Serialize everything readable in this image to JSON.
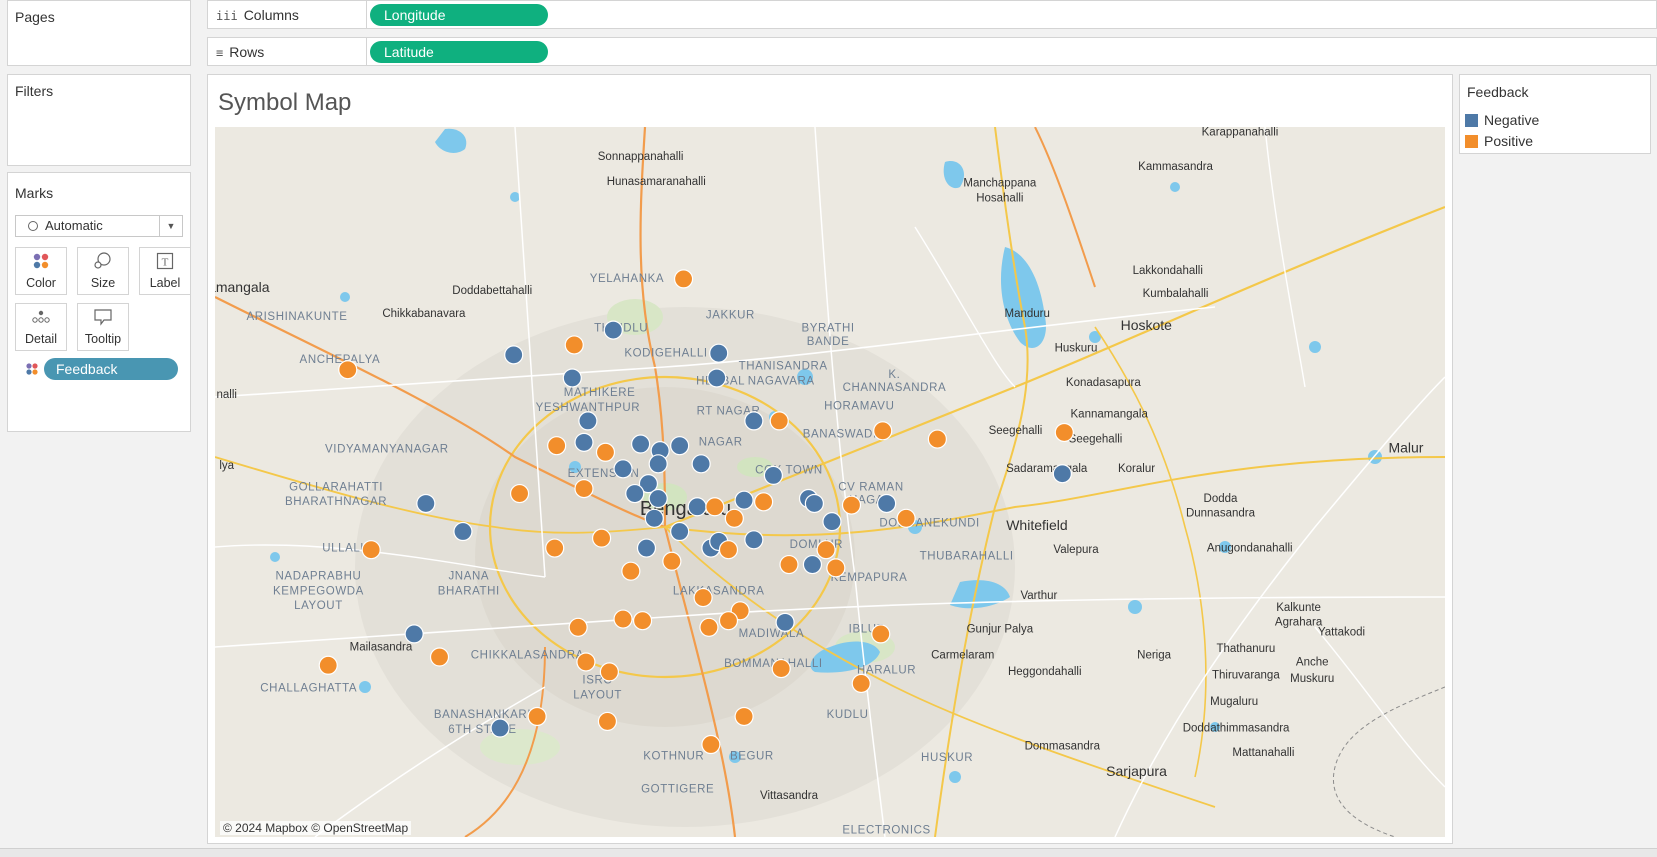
{
  "pages_card": {
    "title": "Pages"
  },
  "filters_card": {
    "title": "Filters"
  },
  "shelves": {
    "columns": {
      "icon": "iii",
      "label": "Columns",
      "pill": "Longitude"
    },
    "rows": {
      "icon": "≡",
      "label": "Rows",
      "pill": "Latitude"
    }
  },
  "marks": {
    "title": "Marks",
    "mark_type": "Automatic",
    "buttons": {
      "color": "Color",
      "size": "Size",
      "label": "Label",
      "detail": "Detail",
      "tooltip": "Tooltip"
    },
    "field_pill": "Feedback"
  },
  "viz": {
    "title": "Symbol Map",
    "attribution": "© 2024 Mapbox © OpenStreetMap"
  },
  "legend": {
    "title": "Feedback",
    "items": [
      {
        "label": "Negative",
        "color": "#4e79a7"
      },
      {
        "label": "Positive",
        "color": "#f28e2b"
      }
    ]
  },
  "colors": {
    "negative": "#4e79a7",
    "positive": "#f28e2b",
    "pill_green": "#0fb07f",
    "pill_blue": "#4996b2"
  },
  "map_labels": [
    {
      "t": "Sonnappanahalli",
      "lon": 77.548,
      "lat": 13.17
    },
    {
      "t": "Hunasamaranahalli",
      "lon": 77.556,
      "lat": 13.155
    },
    {
      "t": "Karappanahalli",
      "lon": 77.855,
      "lat": 13.185
    },
    {
      "t": "Kammasandra",
      "lon": 77.822,
      "lat": 13.164
    },
    {
      "t": "Manchappana",
      "lon": 77.732,
      "lat": 13.154
    },
    {
      "t": "Hosahalli",
      "lon": 77.732,
      "lat": 13.145
    },
    {
      "t": "Lakkondahalli",
      "lon": 77.818,
      "lat": 13.101
    },
    {
      "t": "Kumbalahalli",
      "lon": 77.822,
      "lat": 13.087
    },
    {
      "t": "Elamangala",
      "lon": 77.339,
      "lat": 13.09
    },
    {
      "t": "Doddabettahalli",
      "lon": 77.472,
      "lat": 13.089
    },
    {
      "t": "YELAHANKA",
      "lon": 77.541,
      "lat": 13.096
    },
    {
      "t": "Chikkabanavara",
      "lon": 77.437,
      "lat": 13.075
    },
    {
      "t": "JAKKUR",
      "lon": 77.594,
      "lat": 13.074
    },
    {
      "t": "Manduru",
      "lon": 77.746,
      "lat": 13.075
    },
    {
      "t": "Hoskote",
      "lon": 77.807,
      "lat": 13.067
    },
    {
      "t": "ARISHINAKUNTE",
      "lon": 77.372,
      "lat": 13.073
    },
    {
      "t": "THINDLU",
      "lon": 77.538,
      "lat": 13.066
    },
    {
      "t": "BYRATHI",
      "lon": 77.644,
      "lat": 13.066
    },
    {
      "t": "BANDE",
      "lon": 77.644,
      "lat": 13.058
    },
    {
      "t": "KODIGEHALLI",
      "lon": 77.561,
      "lat": 13.051
    },
    {
      "t": "Huskuru",
      "lon": 77.771,
      "lat": 13.054
    },
    {
      "t": "ANCHEPALYA",
      "lon": 77.394,
      "lat": 13.047
    },
    {
      "t": "THANISANDRA",
      "lon": 77.621,
      "lat": 13.043
    },
    {
      "t": "Konadasapura",
      "lon": 77.785,
      "lat": 13.033
    },
    {
      "t": "HEBBAL",
      "lon": 77.589,
      "lat": 13.034
    },
    {
      "t": "NAGAVARA",
      "lon": 77.62,
      "lat": 13.034
    },
    {
      "t": "K.",
      "lon": 77.678,
      "lat": 13.038
    },
    {
      "t": "CHANNASANDRA",
      "lon": 77.678,
      "lat": 13.03
    },
    {
      "t": "MATHIKERE",
      "lon": 77.527,
      "lat": 13.027
    },
    {
      "t": "Kannamangala",
      "lon": 77.788,
      "lat": 13.014
    },
    {
      "t": "YESHWANTHPUR",
      "lon": 77.521,
      "lat": 13.018
    },
    {
      "t": "RT NAGAR",
      "lon": 77.593,
      "lat": 13.016
    },
    {
      "t": "HORAMAVU",
      "lon": 77.66,
      "lat": 13.019
    },
    {
      "t": "Seegehalli",
      "lon": 77.74,
      "lat": 13.004
    },
    {
      "t": "Seegehalli",
      "lon": 77.781,
      "lat": 12.999
    },
    {
      "t": "BANASWADI",
      "lon": 77.65,
      "lat": 13.002
    },
    {
      "t": "NAGAR",
      "lon": 77.589,
      "lat": 12.997
    },
    {
      "t": "VIDYAMANYANAGAR",
      "lon": 77.418,
      "lat": 12.993
    },
    {
      "t": "Malur",
      "lon": 77.94,
      "lat": 12.993
    },
    {
      "t": "Sadaramangala",
      "lon": 77.756,
      "lat": 12.981
    },
    {
      "t": "Koralur",
      "lon": 77.802,
      "lat": 12.981
    },
    {
      "t": "COX TOWN",
      "lon": 77.624,
      "lat": 12.98
    },
    {
      "t": "EXTENSION",
      "lon": 77.529,
      "lat": 12.978
    },
    {
      "t": "GOLLARAHATTI",
      "lon": 77.392,
      "lat": 12.97
    },
    {
      "t": "CV RAMAN",
      "lon": 77.666,
      "lat": 12.97
    },
    {
      "t": "NAGAR",
      "lon": 77.666,
      "lat": 12.962
    },
    {
      "t": "Dodda",
      "lon": 77.845,
      "lat": 12.963
    },
    {
      "t": "BHARATHNAGAR",
      "lon": 77.392,
      "lat": 12.961
    },
    {
      "t": "Bengaluru",
      "lon": 77.571,
      "lat": 12.955
    },
    {
      "t": "Dunnasandra",
      "lon": 77.845,
      "lat": 12.954
    },
    {
      "t": "DODDANEKUNDI",
      "lon": 77.696,
      "lat": 12.948
    },
    {
      "t": "Whitefield",
      "lon": 77.751,
      "lat": 12.946
    },
    {
      "t": "DOMLUR",
      "lon": 77.638,
      "lat": 12.935
    },
    {
      "t": "ULLALU",
      "lon": 77.397,
      "lat": 12.933
    },
    {
      "t": "Valepura",
      "lon": 77.771,
      "lat": 12.932
    },
    {
      "t": "Anugondanahalli",
      "lon": 77.86,
      "lat": 12.933
    },
    {
      "t": "THUBARAHALLI",
      "lon": 77.715,
      "lat": 12.928
    },
    {
      "t": "NADAPRABHU",
      "lon": 77.383,
      "lat": 12.916
    },
    {
      "t": "JNANA",
      "lon": 77.46,
      "lat": 12.916
    },
    {
      "t": "KEMPAPURA",
      "lon": 77.665,
      "lat": 12.915
    },
    {
      "t": "KEMPEGOWDA",
      "lon": 77.383,
      "lat": 12.907
    },
    {
      "t": "BHARATHI",
      "lon": 77.46,
      "lat": 12.907
    },
    {
      "t": "LAKKASANDRA",
      "lon": 77.588,
      "lat": 12.907
    },
    {
      "t": "Varthur",
      "lon": 77.752,
      "lat": 12.904
    },
    {
      "t": "LAYOUT",
      "lon": 77.383,
      "lat": 12.898
    },
    {
      "t": "Kalkunte",
      "lon": 77.885,
      "lat": 12.897
    },
    {
      "t": "Gunjur Palya",
      "lon": 77.732,
      "lat": 12.884
    },
    {
      "t": "Agrahara",
      "lon": 77.885,
      "lat": 12.888
    },
    {
      "t": "IBLUR",
      "lon": 77.664,
      "lat": 12.884
    },
    {
      "t": "Yattakodi",
      "lon": 77.907,
      "lat": 12.882
    },
    {
      "t": "MADIWALA",
      "lon": 77.615,
      "lat": 12.881
    },
    {
      "t": "Mailasandra",
      "lon": 77.415,
      "lat": 12.873
    },
    {
      "t": "CHIKKALASANDRA",
      "lon": 77.49,
      "lat": 12.868
    },
    {
      "t": "Carmelaram",
      "lon": 77.713,
      "lat": 12.868
    },
    {
      "t": "Neriga",
      "lon": 77.811,
      "lat": 12.868
    },
    {
      "t": "Thathanuru",
      "lon": 77.858,
      "lat": 12.872
    },
    {
      "t": "Anche",
      "lon": 77.892,
      "lat": 12.864
    },
    {
      "t": "BOMMANAHALLI",
      "lon": 77.616,
      "lat": 12.863
    },
    {
      "t": "Heggondahalli",
      "lon": 77.755,
      "lat": 12.858
    },
    {
      "t": "HARALUR",
      "lon": 77.674,
      "lat": 12.859
    },
    {
      "t": "Muskuru",
      "lon": 77.892,
      "lat": 12.854
    },
    {
      "t": "Thiruvaranga",
      "lon": 77.858,
      "lat": 12.856
    },
    {
      "t": "CHALLAGHATTA",
      "lon": 77.378,
      "lat": 12.848
    },
    {
      "t": "ISRO",
      "lon": 77.526,
      "lat": 12.853
    },
    {
      "t": "LAYOUT",
      "lon": 77.526,
      "lat": 12.844
    },
    {
      "t": "Mugaluru",
      "lon": 77.852,
      "lat": 12.84
    },
    {
      "t": "KUDLU",
      "lon": 77.654,
      "lat": 12.832
    },
    {
      "t": "BANASHANKARI",
      "lon": 77.467,
      "lat": 12.832
    },
    {
      "t": "Doddathimmasandra",
      "lon": 77.853,
      "lat": 12.824
    },
    {
      "t": "6TH STAGE",
      "lon": 77.467,
      "lat": 12.823
    },
    {
      "t": "Dommasandra",
      "lon": 77.764,
      "lat": 12.813
    },
    {
      "t": "Mattanahalli",
      "lon": 77.867,
      "lat": 12.809
    },
    {
      "t": "KOTHNUR",
      "lon": 77.565,
      "lat": 12.807
    },
    {
      "t": "BEGUR",
      "lon": 77.605,
      "lat": 12.807
    },
    {
      "t": "HUSKUR",
      "lon": 77.705,
      "lat": 12.806
    },
    {
      "t": "Sarjapura",
      "lon": 77.802,
      "lat": 12.797
    },
    {
      "t": "GOTTIGERE",
      "lon": 77.567,
      "lat": 12.787
    },
    {
      "t": "Vittasandra",
      "lon": 77.624,
      "lat": 12.783
    },
    {
      "t": "ELECTRONICS",
      "lon": 77.674,
      "lat": 12.762
    },
    {
      "t": "nalli",
      "lon": 77.336,
      "lat": 13.026
    },
    {
      "t": "lya",
      "lon": 77.336,
      "lat": 12.983
    }
  ],
  "chart_data": {
    "type": "scatter",
    "title": "Symbol Map",
    "xlabel": "Longitude",
    "ylabel": "Latitude",
    "color_field": "Feedback",
    "series": [
      {
        "name": "Negative",
        "x": [
          77.534,
          77.483,
          77.513,
          77.588,
          77.587,
          77.606,
          77.521,
          77.519,
          77.548,
          77.558,
          77.568,
          77.539,
          77.557,
          77.579,
          77.552,
          77.545,
          77.616,
          77.601,
          77.438,
          77.457,
          77.557,
          77.577,
          77.634,
          77.674,
          77.637,
          77.555,
          77.568,
          77.606,
          77.646,
          77.584,
          77.588,
          77.622,
          77.432,
          77.551,
          77.636,
          77.476,
          77.764
        ],
        "y": [
          13.067,
          13.052,
          13.038,
          13.053,
          13.038,
          13.012,
          13.012,
          12.999,
          12.998,
          12.994,
          12.997,
          12.983,
          12.986,
          12.986,
          12.974,
          12.968,
          12.979,
          12.964,
          12.962,
          12.945,
          12.965,
          12.96,
          12.965,
          12.962,
          12.962,
          12.953,
          12.945,
          12.94,
          12.951,
          12.935,
          12.939,
          12.89,
          12.883,
          12.935,
          12.925,
          12.826,
          12.98
        ]
      },
      {
        "name": "Positive",
        "x": [
          77.57,
          77.514,
          77.398,
          77.619,
          77.672,
          77.7,
          77.765,
          77.505,
          77.53,
          77.486,
          77.519,
          77.656,
          77.586,
          77.611,
          77.504,
          77.528,
          77.596,
          77.543,
          77.549,
          77.593,
          77.643,
          77.58,
          77.599,
          77.564,
          77.624,
          77.648,
          77.516,
          77.539,
          77.593,
          77.583,
          77.52,
          77.671,
          77.41,
          77.388,
          77.445,
          77.62,
          77.661,
          77.495,
          77.684,
          77.532,
          77.584,
          77.601,
          77.531
        ],
        "y": [
          13.098,
          13.058,
          13.043,
          13.012,
          13.006,
          13.001,
          13.005,
          12.997,
          12.993,
          12.968,
          12.971,
          12.961,
          12.96,
          12.963,
          12.935,
          12.941,
          12.953,
          12.921,
          12.891,
          12.934,
          12.934,
          12.905,
          12.897,
          12.927,
          12.925,
          12.923,
          12.887,
          12.892,
          12.891,
          12.887,
          12.866,
          12.883,
          12.934,
          12.864,
          12.869,
          12.862,
          12.853,
          12.833,
          12.953,
          12.86,
          12.816,
          12.833,
          12.83
        ]
      }
    ],
    "xlim": [
      77.33,
      77.96
    ],
    "ylim": [
      12.76,
      13.19
    ],
    "legend": "right"
  }
}
